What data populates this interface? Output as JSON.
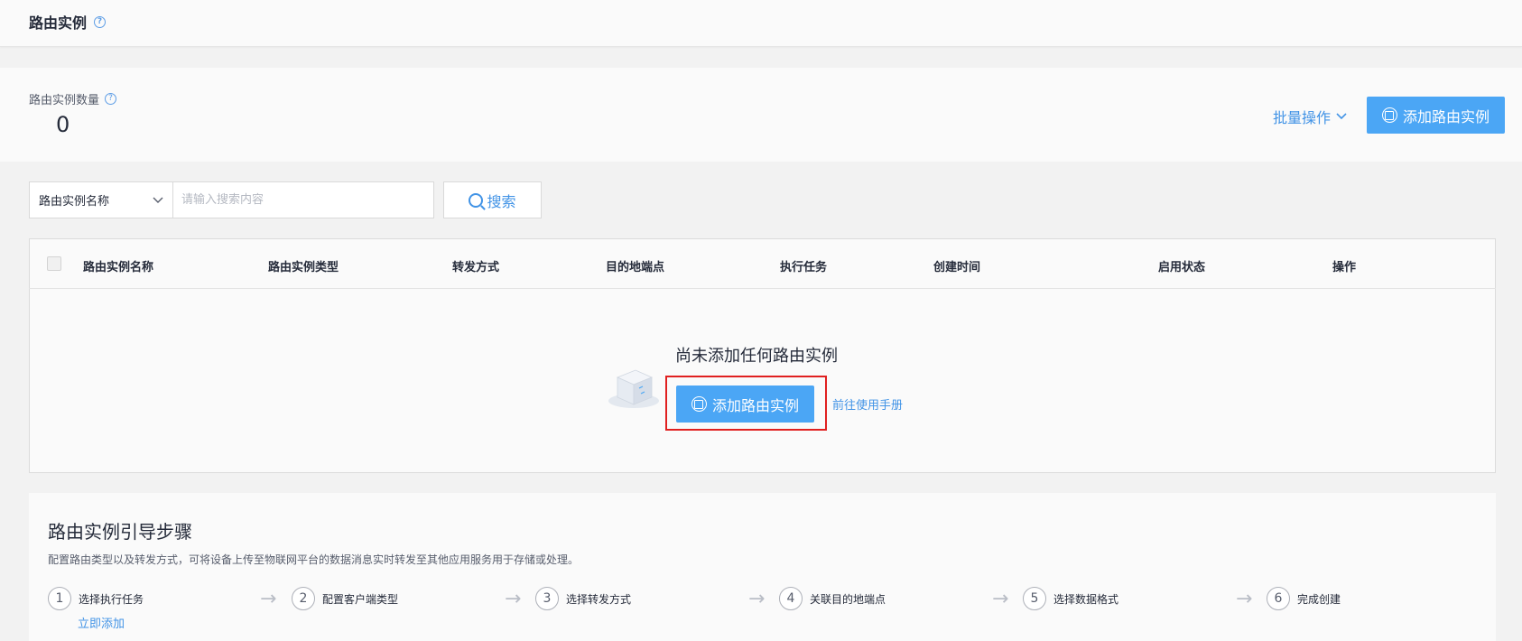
{
  "header": {
    "title": "路由实例",
    "help_icon": "question-circle-icon"
  },
  "stats": {
    "label": "路由实例数量",
    "value": "0",
    "batch_label": "批量操作",
    "add_label": "添加路由实例"
  },
  "search": {
    "field_selected": "路由实例名称",
    "placeholder": "请输入搜索内容",
    "button_label": "搜索"
  },
  "table": {
    "columns": [
      "路由实例名称",
      "路由实例类型",
      "转发方式",
      "目的地端点",
      "执行任务",
      "创建时间",
      "启用状态",
      "操作"
    ]
  },
  "empty_state": {
    "title": "尚未添加任何路由实例",
    "add_label": "添加路由实例",
    "manual_link": "前往使用手册"
  },
  "guide": {
    "title": "路由实例引导步骤",
    "description": "配置路由类型以及转发方式，可将设备上传至物联网平台的数据消息实时转发至其他应用服务用于存储或处理。",
    "steps": [
      {
        "num": "1",
        "label": "选择执行任务"
      },
      {
        "num": "2",
        "label": "配置客户端类型"
      },
      {
        "num": "3",
        "label": "选择转发方式"
      },
      {
        "num": "4",
        "label": "关联目的地端点"
      },
      {
        "num": "5",
        "label": "选择数据格式"
      },
      {
        "num": "6",
        "label": "完成创建"
      }
    ],
    "add_now": "立即添加"
  },
  "colors": {
    "primary": "#4ba6f5",
    "link": "#4193e6",
    "highlight_border": "#e02020"
  }
}
